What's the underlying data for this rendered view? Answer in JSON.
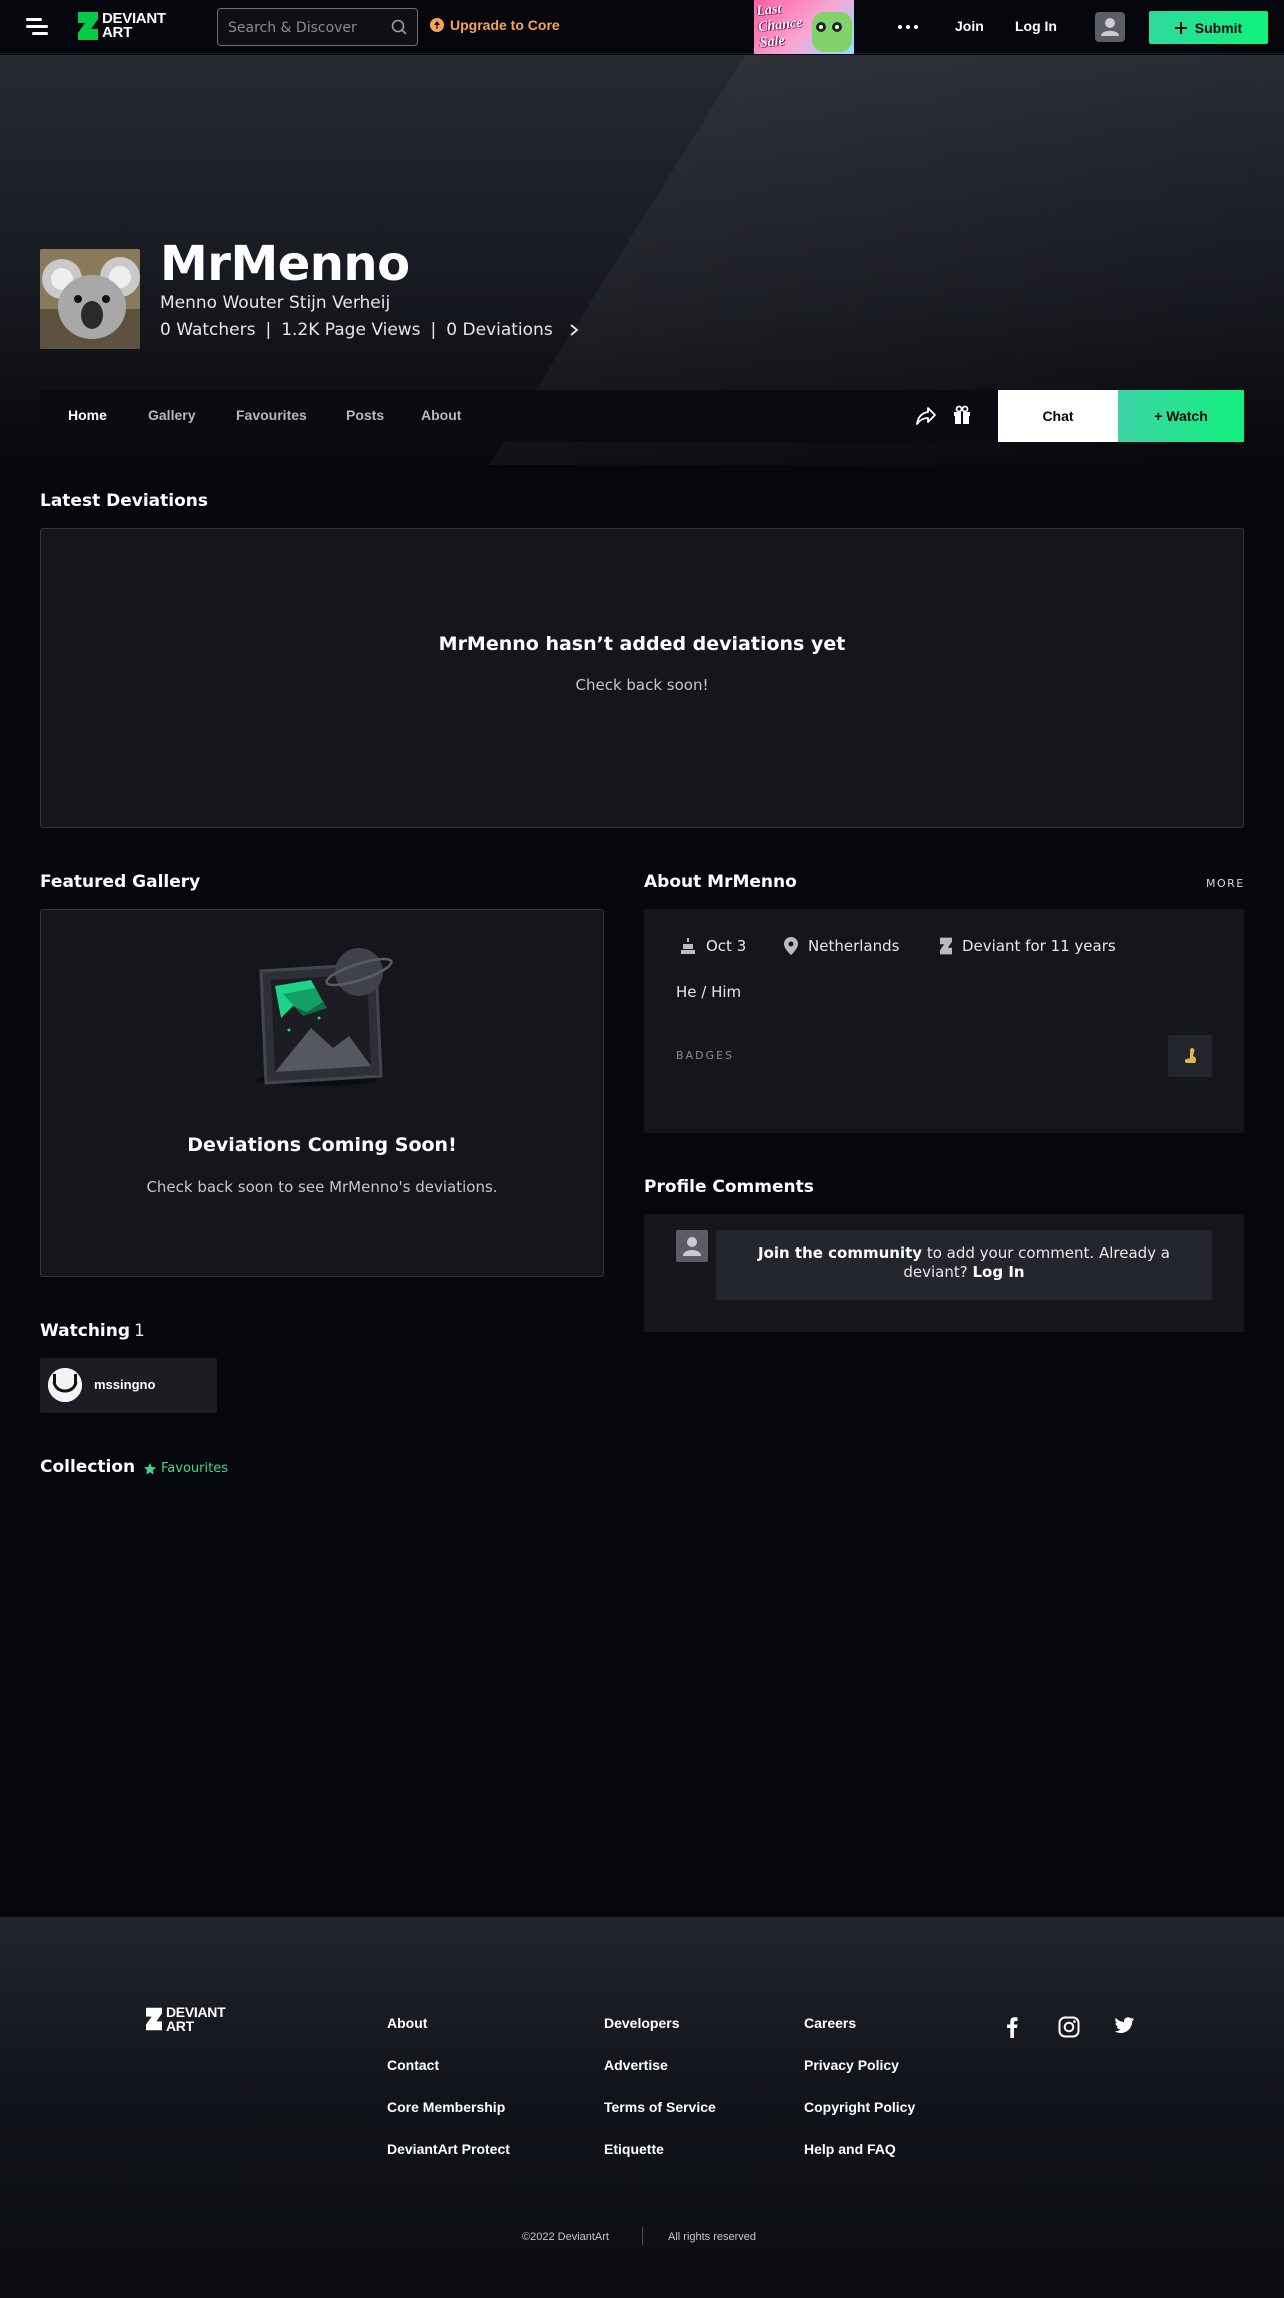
{
  "topbar": {
    "logo_line1": "DEVIANT",
    "logo_line2": "ART",
    "search_placeholder": "Search & Discover",
    "upgrade_label": "Upgrade to Core",
    "promo_text": "Last Chance Sale",
    "join_label": "Join",
    "login_label": "Log In",
    "submit_label": "Submit"
  },
  "profile": {
    "username": "MrMenno",
    "real_name": "Menno Wouter Stijn Verheij",
    "watchers": "0 Watchers",
    "page_views": "1.2K Page Views",
    "deviations": "0 Deviations",
    "separator": "|"
  },
  "tabs": {
    "home": "Home",
    "gallery": "Gallery",
    "favourites": "Favourites",
    "posts": "Posts",
    "about": "About",
    "chat": "Chat",
    "watch": "+ Watch"
  },
  "latest": {
    "title": "Latest Deviations",
    "empty_title": "MrMenno hasn’t added deviations yet",
    "empty_sub": "Check back soon!"
  },
  "featured": {
    "title": "Featured Gallery",
    "empty_title": "Deviations Coming Soon!",
    "empty_sub": "Check back soon to see MrMenno's deviations."
  },
  "about": {
    "title": "About MrMenno",
    "more": "MORE",
    "birthday": "Oct 3",
    "location": "Netherlands",
    "member_for": "Deviant for 11 years",
    "pronouns": "He / Him",
    "badges_label": "BADGES"
  },
  "comments": {
    "title": "Profile Comments",
    "join_bold": "Join the community",
    "join_rest": " to add your comment. Already a deviant? ",
    "login_bold": "Log In"
  },
  "watching": {
    "title": "Watching",
    "count": "1",
    "user": "mssingno"
  },
  "collection": {
    "title": "Collection",
    "tag": "Favourites"
  },
  "footer": {
    "col1": [
      "About",
      "Contact",
      "Core Membership",
      "DeviantArt Protect"
    ],
    "col2": [
      "Developers",
      "Advertise",
      "Terms of Service",
      "Etiquette"
    ],
    "col3": [
      "Careers",
      "Privacy Policy",
      "Copyright Policy",
      "Help and FAQ"
    ],
    "copyright": "©2022 DeviantArt",
    "rights": "All rights reserved"
  },
  "colors": {
    "accent_green": "#10f27a",
    "upgrade_orange": "#f5a35c",
    "background": "#06070d"
  },
  "icons": [
    "menu-icon",
    "deviantart-logo-icon",
    "search-icon",
    "upgrade-icon",
    "more-dots-icon",
    "user-icon",
    "plus-icon",
    "chevron-right-icon",
    "share-icon",
    "gift-icon",
    "cake-icon",
    "location-pin-icon",
    "deviantart-icon",
    "badge-icon",
    "star-icon",
    "facebook-icon",
    "instagram-icon",
    "twitter-icon"
  ]
}
